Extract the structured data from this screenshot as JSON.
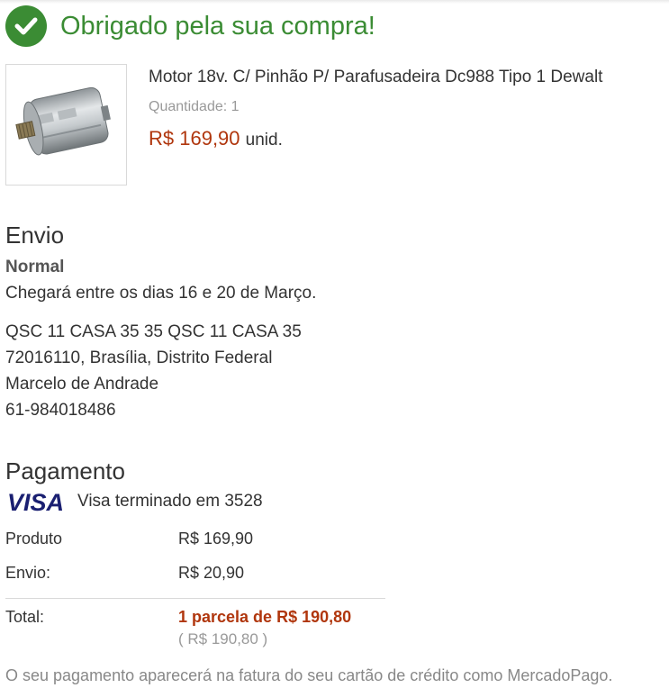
{
  "header": {
    "title": "Obrigado pela sua compra!"
  },
  "product": {
    "name": "Motor 18v. C/ Pinhão P/ Parafusadeira Dc988 Tipo 1 Dewalt",
    "quantity": "Quantidade: 1",
    "price": "R$ 169,90",
    "unit": "unid."
  },
  "shipping": {
    "title": "Envio",
    "method": "Normal",
    "eta": "Chegará entre os dias 16 e 20 de Março.",
    "address_line1": "QSC 11 CASA 35 35 QSC 11 CASA 35",
    "address_line2": "72016110, Brasília, Distrito Federal",
    "recipient": "Marcelo de Andrade",
    "phone": "61-984018486"
  },
  "payment": {
    "title": "Pagamento",
    "card_brand": "VISA",
    "card_text": "Visa terminado em 3528",
    "product_label": "Produto",
    "product_value": "R$ 169,90",
    "shipping_label": "Envio:",
    "shipping_value": "R$ 20,90",
    "total_label": "Total:",
    "total_value": "1 parcela de R$ 190,80",
    "total_sub": "( R$ 190,80 )",
    "footnote": "O seu pagamento aparecerá na fatura do seu cartão de crédito como MercadoPago."
  },
  "colors": {
    "success": "#3b8c34",
    "price": "#b0360d",
    "visa": "#1a1f71"
  },
  "icons": {
    "confirm": "check-circle-icon",
    "product": "product-image",
    "card": "visa-logo"
  }
}
